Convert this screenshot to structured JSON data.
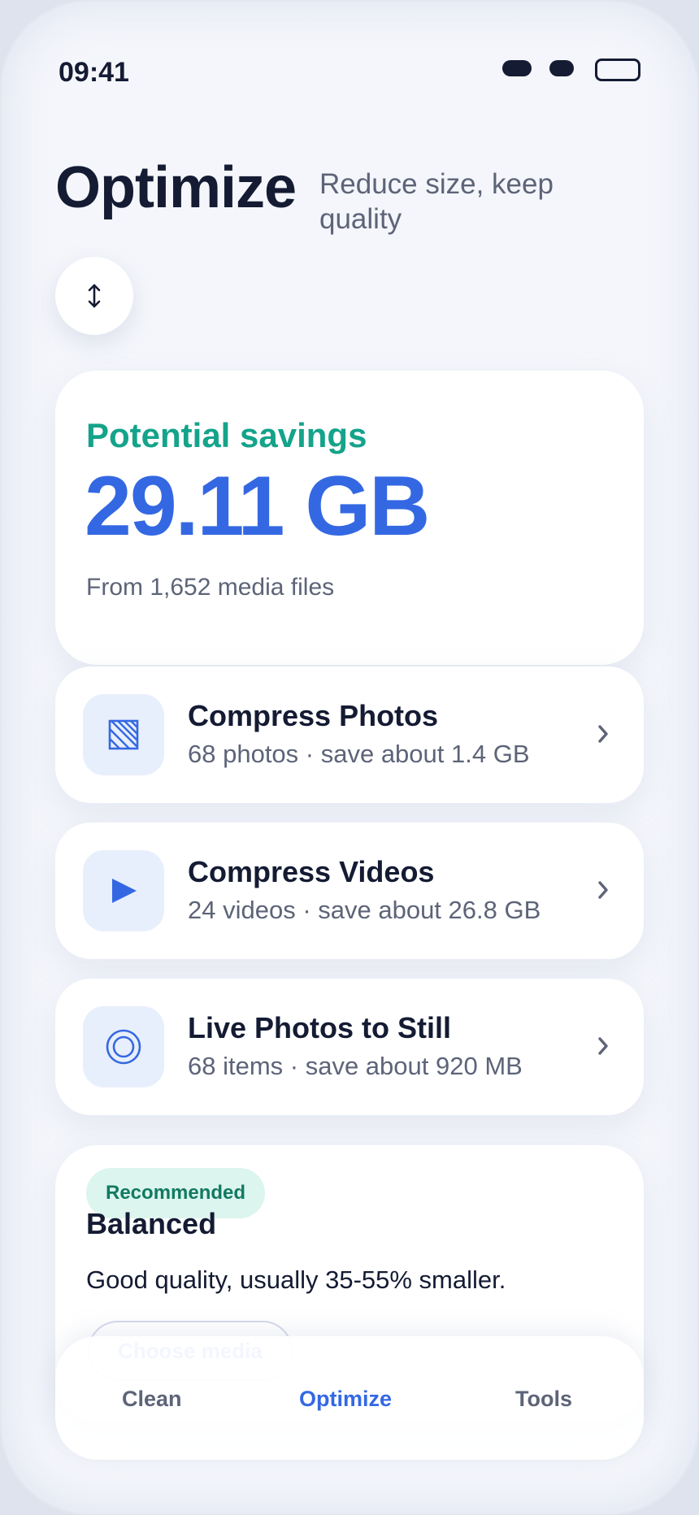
{
  "status_bar": {
    "time": "09:41"
  },
  "header": {
    "title": "Optimize",
    "subtitle": "Reduce size, keep quality"
  },
  "sort_button": {
    "icon": "up-down-arrow-icon"
  },
  "savings": {
    "label": "Potential savings",
    "value": "29.11 GB",
    "subtitle": "From 1,652 media files"
  },
  "options": [
    {
      "title": "Compress Photos",
      "subtitle": "68 photos · save about 1.4 GB",
      "icon": "photo-hatch-icon"
    },
    {
      "title": "Compress Videos",
      "subtitle": "24 videos · save about 26.8 GB",
      "icon": "play-icon"
    },
    {
      "title": "Live Photos to Still",
      "subtitle": "68 items · save about 920 MB",
      "icon": "live-photo-icon"
    }
  ],
  "preset": {
    "badge": "Recommended",
    "name": "Balanced",
    "description": "Good quality, usually 35-55% smaller.",
    "button": "Choose media"
  },
  "tabs": [
    {
      "label": "Clean",
      "active": false
    },
    {
      "label": "Optimize",
      "active": true
    },
    {
      "label": "Tools",
      "active": false
    }
  ],
  "colors": {
    "accent": "#3468e3",
    "savings_label": "#14a38b",
    "badge_bg": "#dcf5ee",
    "badge_text": "#127a62",
    "text_primary": "#141b33",
    "text_secondary": "#5d6478",
    "background": "#f4f6fb"
  }
}
